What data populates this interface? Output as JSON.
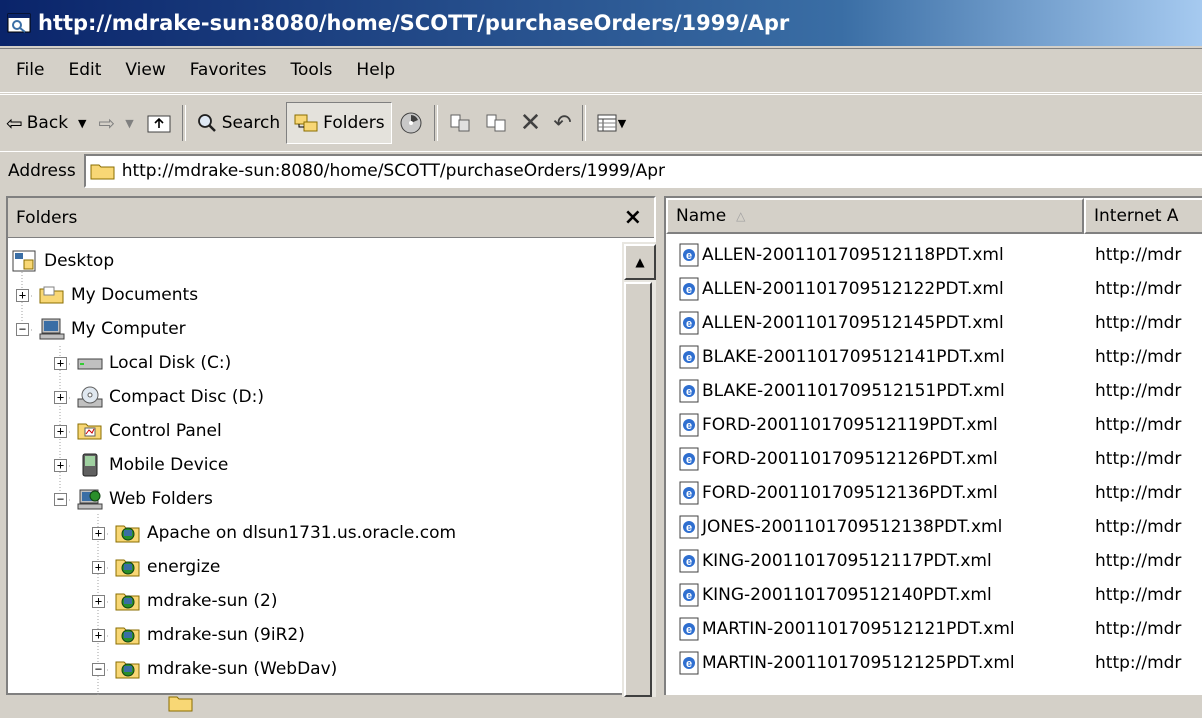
{
  "window": {
    "title": "http://mdrake-sun:8080/home/SCOTT/purchaseOrders/1999/Apr"
  },
  "menu": [
    "File",
    "Edit",
    "View",
    "Favorites",
    "Tools",
    "Help"
  ],
  "toolbar": {
    "back": "Back",
    "search": "Search",
    "folders": "Folders"
  },
  "address": {
    "label": "Address",
    "value": "http://mdrake-sun:8080/home/SCOTT/purchaseOrders/1999/Apr"
  },
  "folders_pane": {
    "title": "Folders",
    "close": "×",
    "tree": [
      {
        "label": "Desktop",
        "icon": "desktop-icon",
        "expander": ""
      },
      {
        "label": "My Documents",
        "icon": "my-documents-icon",
        "expander": "+"
      },
      {
        "label": "My Computer",
        "icon": "my-computer-icon",
        "expander": "−"
      },
      {
        "label": "Local Disk (C:)",
        "icon": "hard-disk-icon",
        "expander": "+"
      },
      {
        "label": "Compact Disc (D:)",
        "icon": "cd-drive-icon",
        "expander": "+"
      },
      {
        "label": "Control Panel",
        "icon": "control-panel-icon",
        "expander": "+"
      },
      {
        "label": "Mobile Device",
        "icon": "mobile-device-icon",
        "expander": "+"
      },
      {
        "label": "Web Folders",
        "icon": "web-folders-icon",
        "expander": "−"
      },
      {
        "label": "Apache on dlsun1731.us.oracle.com",
        "icon": "web-folder-icon",
        "expander": "+"
      },
      {
        "label": "energize",
        "icon": "web-folder-icon",
        "expander": "+"
      },
      {
        "label": "mdrake-sun (2)",
        "icon": "web-folder-icon",
        "expander": "+"
      },
      {
        "label": "mdrake-sun (9iR2)",
        "icon": "web-folder-icon",
        "expander": "+"
      },
      {
        "label": "mdrake-sun (WebDav)",
        "icon": "web-folder-icon",
        "expander": "−"
      }
    ]
  },
  "file_list": {
    "columns": [
      "Name",
      "Internet A"
    ],
    "rows": [
      {
        "name": "ALLEN-2001101709512118PDT.xml",
        "url": "http://mdr"
      },
      {
        "name": "ALLEN-2001101709512122PDT.xml",
        "url": "http://mdr"
      },
      {
        "name": "ALLEN-2001101709512145PDT.xml",
        "url": "http://mdr"
      },
      {
        "name": "BLAKE-2001101709512141PDT.xml",
        "url": "http://mdr"
      },
      {
        "name": "BLAKE-2001101709512151PDT.xml",
        "url": "http://mdr"
      },
      {
        "name": "FORD-2001101709512119PDT.xml",
        "url": "http://mdr"
      },
      {
        "name": "FORD-2001101709512126PDT.xml",
        "url": "http://mdr"
      },
      {
        "name": "FORD-2001101709512136PDT.xml",
        "url": "http://mdr"
      },
      {
        "name": "JONES-2001101709512138PDT.xml",
        "url": "http://mdr"
      },
      {
        "name": "KING-2001101709512117PDT.xml",
        "url": "http://mdr"
      },
      {
        "name": "KING-2001101709512140PDT.xml",
        "url": "http://mdr"
      },
      {
        "name": "MARTIN-2001101709512121PDT.xml",
        "url": "http://mdr"
      },
      {
        "name": "MARTIN-2001101709512125PDT.xml",
        "url": "http://mdr"
      }
    ]
  }
}
